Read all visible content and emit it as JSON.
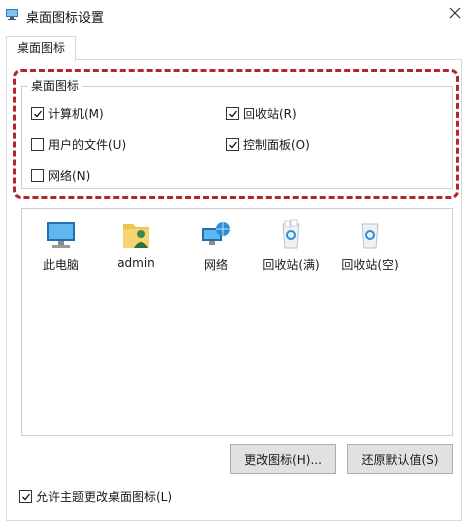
{
  "window": {
    "title": "桌面图标设置",
    "close_icon": "close-icon"
  },
  "tab": {
    "label": "桌面图标"
  },
  "group": {
    "label": "桌面图标",
    "highlight_color": "#b3262b",
    "checkboxes": [
      {
        "label": "计算机(M)",
        "checked": true
      },
      {
        "label": "回收站(R)",
        "checked": true
      },
      {
        "label": "用户的文件(U)",
        "checked": false
      },
      {
        "label": "控制面板(O)",
        "checked": true
      },
      {
        "label": "网络(N)",
        "checked": false
      }
    ]
  },
  "icons": [
    {
      "label": "此电脑",
      "icon": "computer-icon"
    },
    {
      "label": "admin",
      "icon": "user-folder-icon"
    },
    {
      "label": "网络",
      "icon": "network-icon"
    },
    {
      "label": "回收站(满)",
      "icon": "recycle-bin-full-icon"
    },
    {
      "label": "回收站(空)",
      "icon": "recycle-bin-empty-icon"
    }
  ],
  "buttons": {
    "change_icon": "更改图标(H)...",
    "restore_default": "还原默认值(S)"
  },
  "allow_theme": {
    "label": "允许主题更改桌面图标(L)",
    "checked": true
  }
}
